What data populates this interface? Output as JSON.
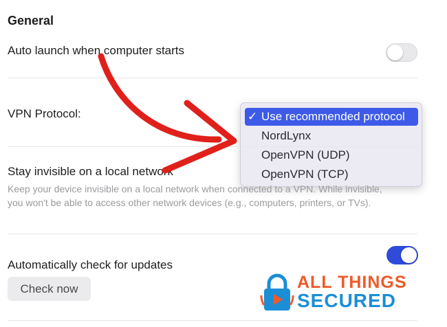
{
  "section": {
    "title": "General"
  },
  "auto_launch": {
    "label": "Auto launch when computer starts",
    "enabled": false
  },
  "vpn_protocol": {
    "label": "VPN Protocol:",
    "options": [
      "Use recommended protocol",
      "NordLynx",
      "OpenVPN (UDP)",
      "OpenVPN (TCP)"
    ],
    "selected_check": "✓"
  },
  "invisible": {
    "label": "Stay invisible on a local network",
    "description": "Keep your device invisible on a local network when connected to a VPN. While invisible, you won't be able to access other network devices (e.g., computers, printers, or TVs)."
  },
  "updates": {
    "label": "Automatically check for updates",
    "enabled": true,
    "button": "Check now"
  },
  "watermark": {
    "line1": "ALL THINGS",
    "line2": "SECURED"
  },
  "colors": {
    "accent": "#3d5be8",
    "toggle_on": "#2f4bd9",
    "arrow": "#e0201b",
    "brand_orange": "#ef5a29",
    "brand_blue": "#1b8ed6"
  }
}
